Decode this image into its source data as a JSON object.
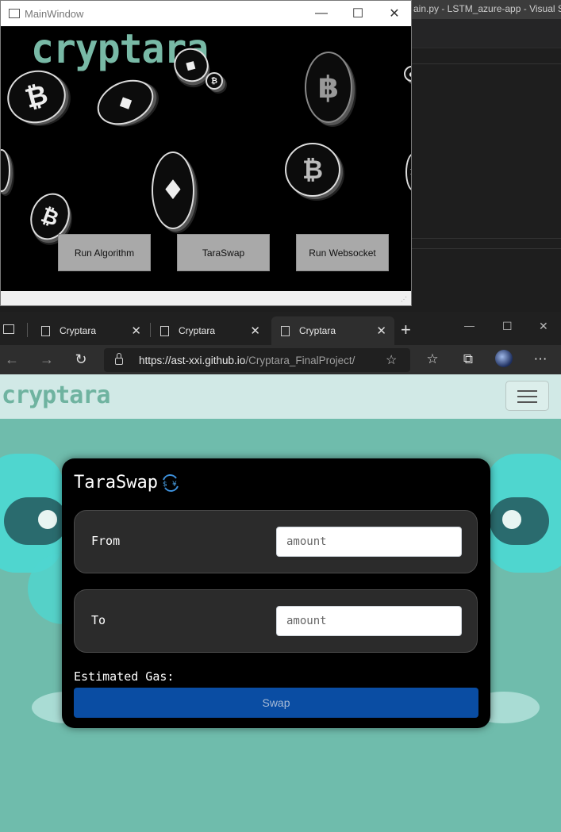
{
  "vscode": {
    "title": "ain.py - LSTM_azure-app - Visual Stu"
  },
  "qt_window": {
    "title": "MainWindow",
    "logo": "cryptara",
    "controls": {
      "minimize": "—",
      "maximize": "☐",
      "close": "✕"
    },
    "buttons": [
      "Run Algorithm",
      "TaraSwap",
      "Run Websocket"
    ]
  },
  "browser": {
    "tabs": [
      {
        "title": "Cryptara",
        "active": false
      },
      {
        "title": "Cryptara",
        "active": false
      },
      {
        "title": "Cryptara",
        "active": true
      }
    ],
    "url_host": "https://ast-xxi.github.io",
    "url_path": "/Cryptara_FinalProject/",
    "window_controls": {
      "minimize": "—",
      "maximize": "☐",
      "close": "✕"
    }
  },
  "page": {
    "site_logo": "cryptara",
    "card": {
      "title": "TaraSwap",
      "from_label": "From",
      "to_label": "To",
      "from_placeholder": "amount",
      "to_placeholder": "amount",
      "gas_label": "Estimated Gas:",
      "swap_label": "Swap"
    }
  },
  "colors": {
    "page_bg": "#6fbcac",
    "navbar_bg": "#d1e9e6",
    "logo": "#6fb3a0",
    "swap_button": "#0a4da3",
    "card_bg": "#000000"
  }
}
